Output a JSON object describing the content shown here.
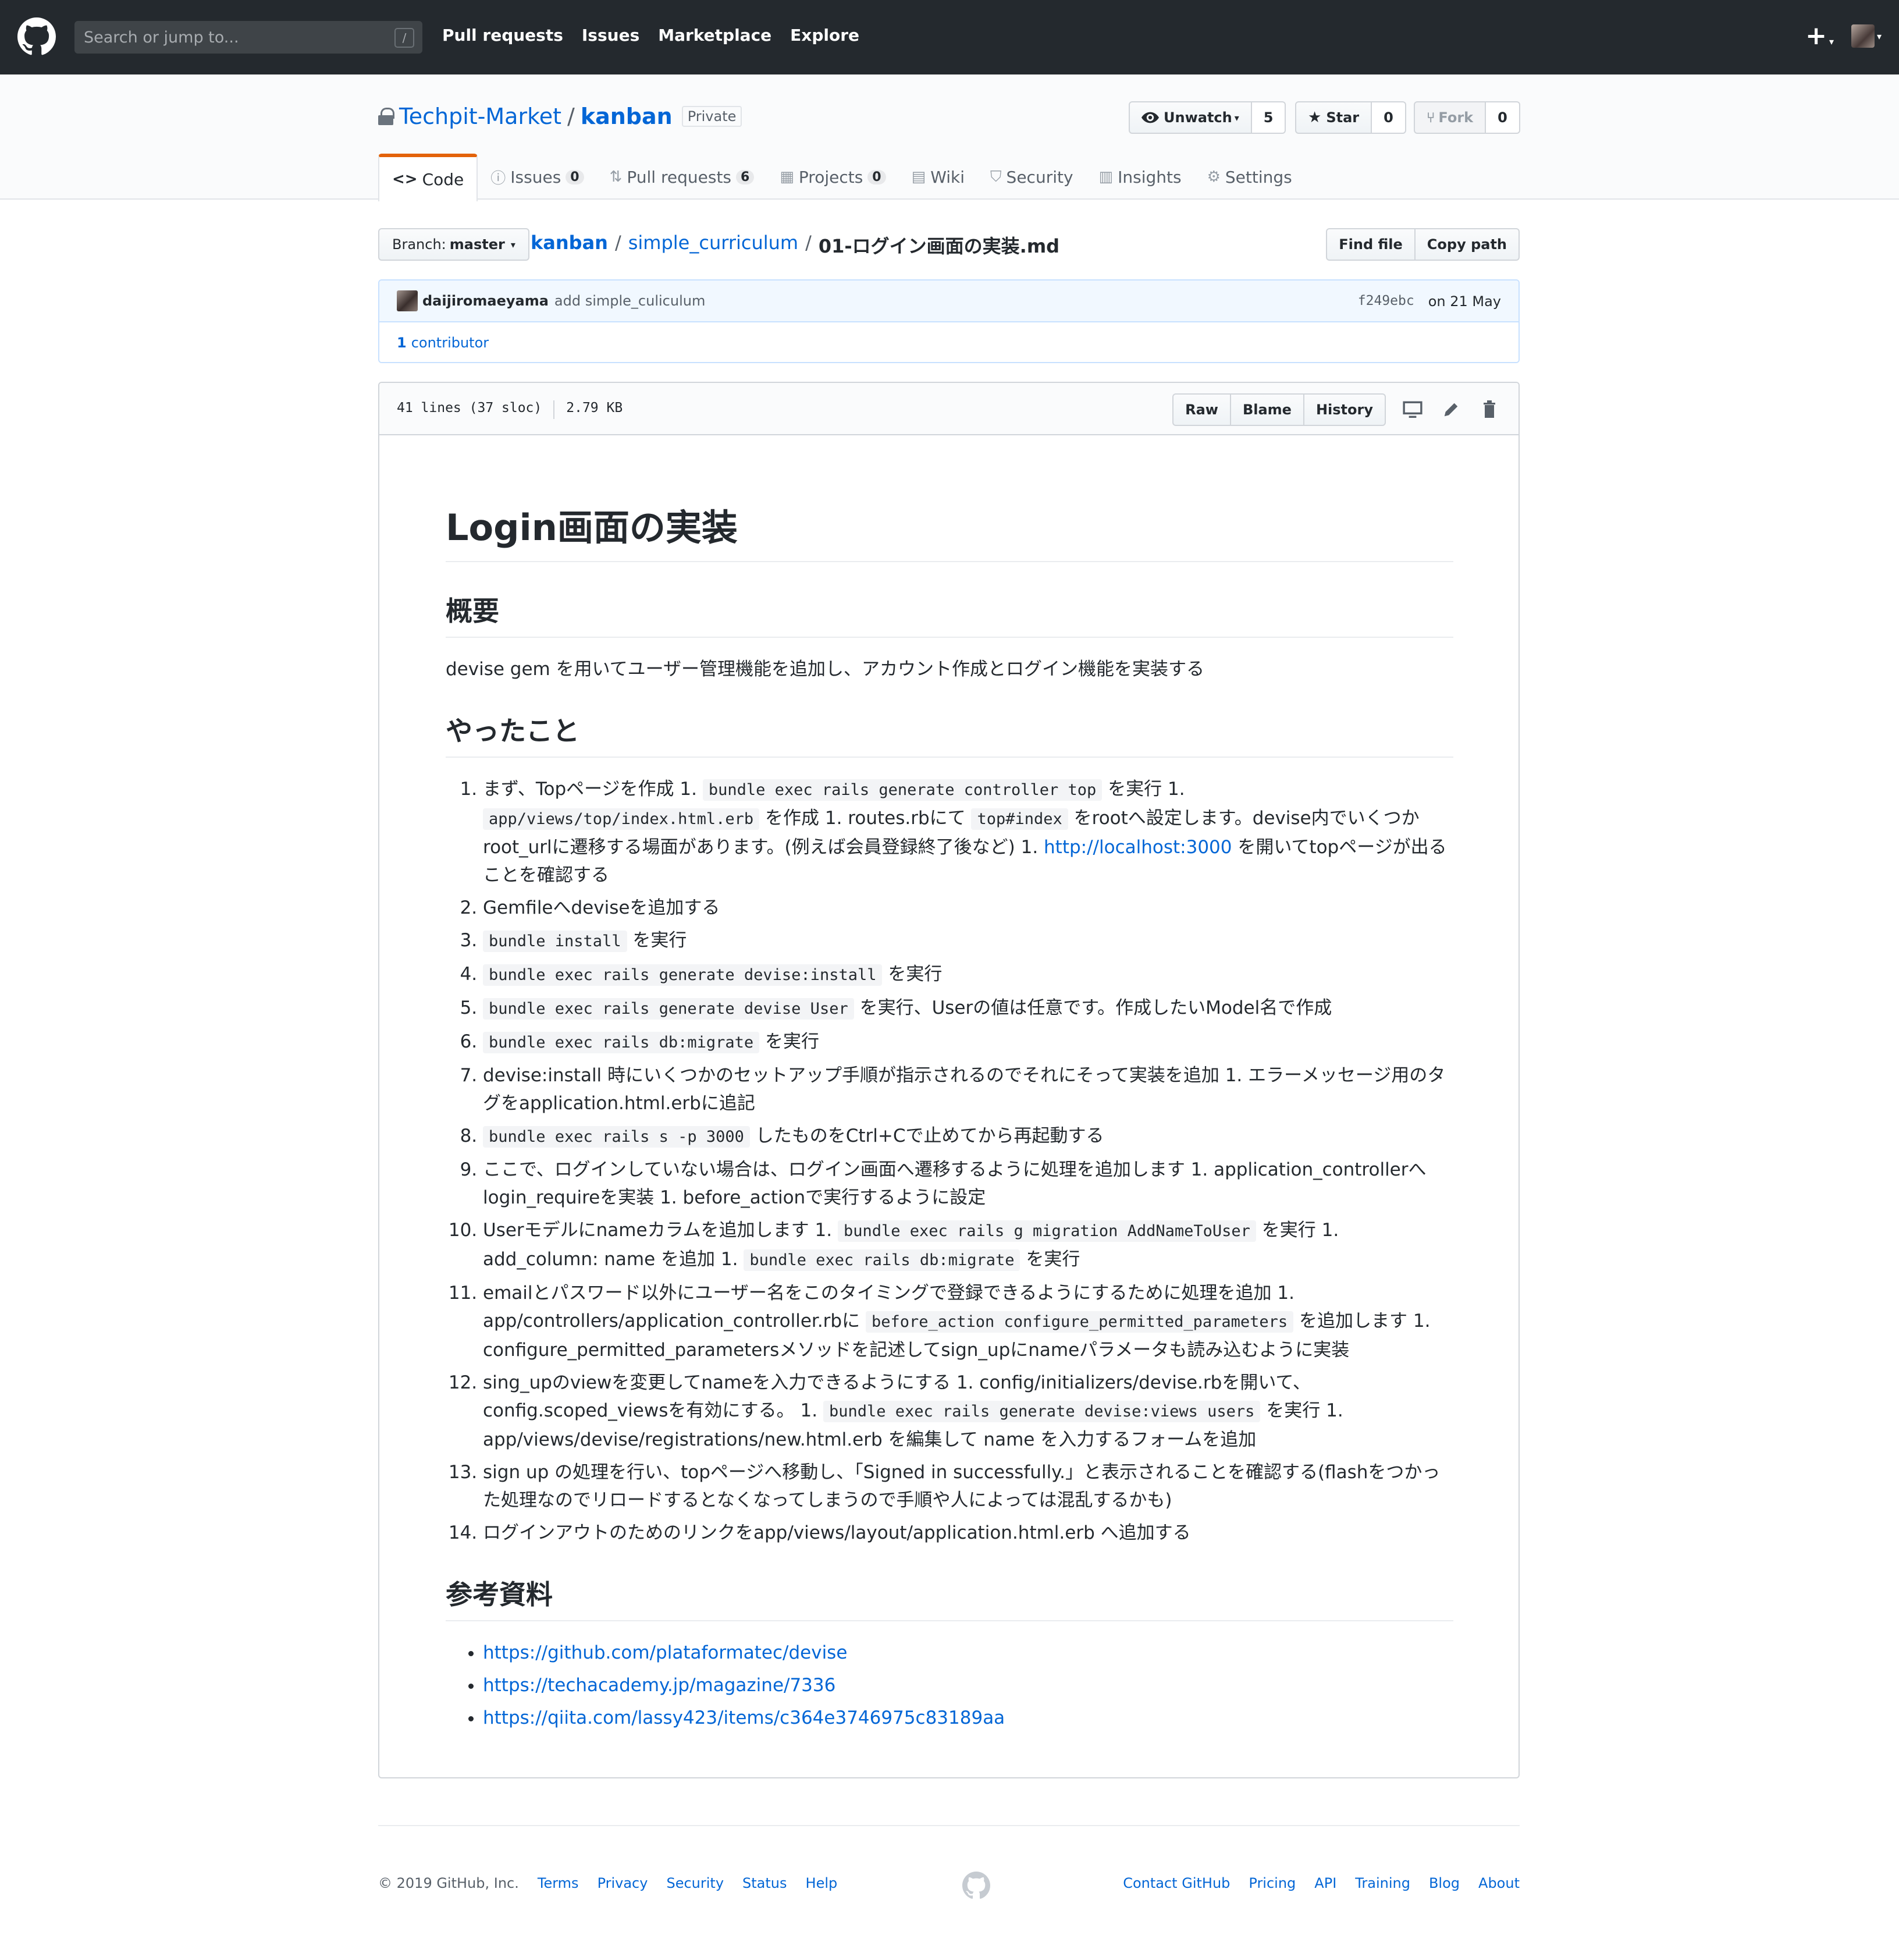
{
  "header": {
    "search_placeholder": "Search or jump to...",
    "search_hotkey": "/",
    "nav": [
      "Pull requests",
      "Issues",
      "Marketplace",
      "Explore"
    ],
    "plus_icon": "+",
    "caret": "▾"
  },
  "repo": {
    "owner": "Techpit-Market",
    "separator": "/",
    "name": "kanban",
    "visibility": "Private",
    "unwatch_label": "Unwatch",
    "watch_count": "5",
    "star_label": "Star",
    "star_count": "0",
    "fork_label": "Fork",
    "fork_count": "0",
    "tabs": [
      {
        "label": "Code",
        "icon": "<>",
        "count": ""
      },
      {
        "label": "Issues",
        "icon": "ⓘ",
        "count": "0"
      },
      {
        "label": "Pull requests",
        "icon": "⇅",
        "count": "6"
      },
      {
        "label": "Projects",
        "icon": "▦",
        "count": "0"
      },
      {
        "label": "Wiki",
        "icon": "▤",
        "count": ""
      },
      {
        "label": "Security",
        "icon": "⛉",
        "count": ""
      },
      {
        "label": "Insights",
        "icon": "▥",
        "count": ""
      },
      {
        "label": "Settings",
        "icon": "⚙",
        "count": ""
      }
    ]
  },
  "filenav": {
    "branch_prefix": "Branch:",
    "branch": "master",
    "breadcrumb_root": "kanban",
    "breadcrumb_dir": "simple_curriculum",
    "breadcrumb_file": "01-ログイン画面の実装.md",
    "find_file": "Find file",
    "copy_path": "Copy path"
  },
  "commit": {
    "author": "daijiromaeyama",
    "message": "add simple_culiculum",
    "sha": "f249ebc",
    "date": "on 21 May",
    "contributors_count": "1",
    "contributors_label": "contributor"
  },
  "file": {
    "lines": "41 lines (37 sloc)",
    "size": "2.79 KB",
    "raw": "Raw",
    "blame": "Blame",
    "history": "History"
  },
  "markdown": {
    "h1": "Login画面の実装",
    "h2_overview": "概要",
    "overview_text": "devise gem を用いてユーザー管理機能を追加し、アカウント作成とログイン機能を実装する",
    "h2_done": "やったこと",
    "steps": {
      "s1": {
        "a": "まず、Topページを作成 1. ",
        "c1": "bundle exec rails generate controller top",
        "b": " を実行 1. ",
        "c2": "app/views/top/index.html.erb",
        "d": " を作成 1. routes.rbにて ",
        "c3": "top#index",
        "e": " をrootへ設定します。devise内でいくつかroot_urlに遷移する場面があります。(例えば会員登録終了後など) 1. ",
        "link": "http://localhost:3000",
        "f": " を開いてtopページが出ることを確認する"
      },
      "s2": "Gemfileへdeviseを追加する",
      "s3": {
        "c": "bundle install",
        "t": " を実行"
      },
      "s4": {
        "c": "bundle exec rails generate devise:install",
        "t": " を実行"
      },
      "s5": {
        "c": "bundle exec rails generate devise User",
        "t": " を実行、Userの値は任意です。作成したいModel名で作成"
      },
      "s6": {
        "c": "bundle exec rails db:migrate",
        "t": " を実行"
      },
      "s7": "devise:install 時にいくつかのセットアップ手順が指示されるのでそれにそって実装を追加 1. エラーメッセージ用のタグをapplication.html.erbに追記",
      "s8": {
        "c": "bundle exec rails s -p 3000",
        "t": " したものをCtrl+Cで止めてから再起動する"
      },
      "s9": "ここで、ログインしていない場合は、ログイン画面へ遷移するように処理を追加します 1. application_controllerへlogin_requireを実装 1. before_actionで実行するように設定",
      "s10": {
        "a": "Userモデルにnameカラムを追加します 1. ",
        "c1": "bundle exec rails g migration AddNameToUser",
        "b": " を実行 1. add_column: name を追加 1. ",
        "c2": "bundle exec rails db:migrate",
        "d": " を実行"
      },
      "s11": {
        "a": "emailとパスワード以外にユーザー名をこのタイミングで登録できるようにするために処理を追加 1. app/controllers/application_controller.rbに ",
        "c1": "before_action configure_permitted_parameters",
        "b": " を追加します 1. configure_permitted_parametersメソッドを記述してsign_upにnameパラメータも読み込むように実装"
      },
      "s12": {
        "a": "sing_upのviewを変更してnameを入力できるようにする 1. config/initializers/devise.rbを開いて、config.scoped_viewsを有効にする。 1. ",
        "c1": "bundle exec rails generate devise:views users",
        "b": " を実行 1. app/views/devise/registrations/new.html.erb を編集して name を入力するフォームを追加"
      },
      "s13": "sign up の処理を行い、topページへ移動し、「Signed in successfully.」と表示されることを確認する(flashをつかった処理なのでリロードするとなくなってしまうので手順や人によっては混乱するかも)",
      "s14": "ログインアウトのためのリンクをapp/views/layout/application.html.erb へ追加する"
    },
    "h2_refs": "参考資料",
    "refs": [
      "https://github.com/plataformatec/devise",
      "https://techacademy.jp/magazine/7336",
      "https://qiita.com/lassy423/items/c364e3746975c83189aa"
    ]
  },
  "footer": {
    "copyright": "© 2019 GitHub, Inc.",
    "left_links": [
      "Terms",
      "Privacy",
      "Security",
      "Status",
      "Help"
    ],
    "right_links": [
      "Contact GitHub",
      "Pricing",
      "API",
      "Training",
      "Blog",
      "About"
    ]
  },
  "colors": {
    "header_bg": "#24292e",
    "link": "#0366d6",
    "tab_accent": "#e36209"
  }
}
